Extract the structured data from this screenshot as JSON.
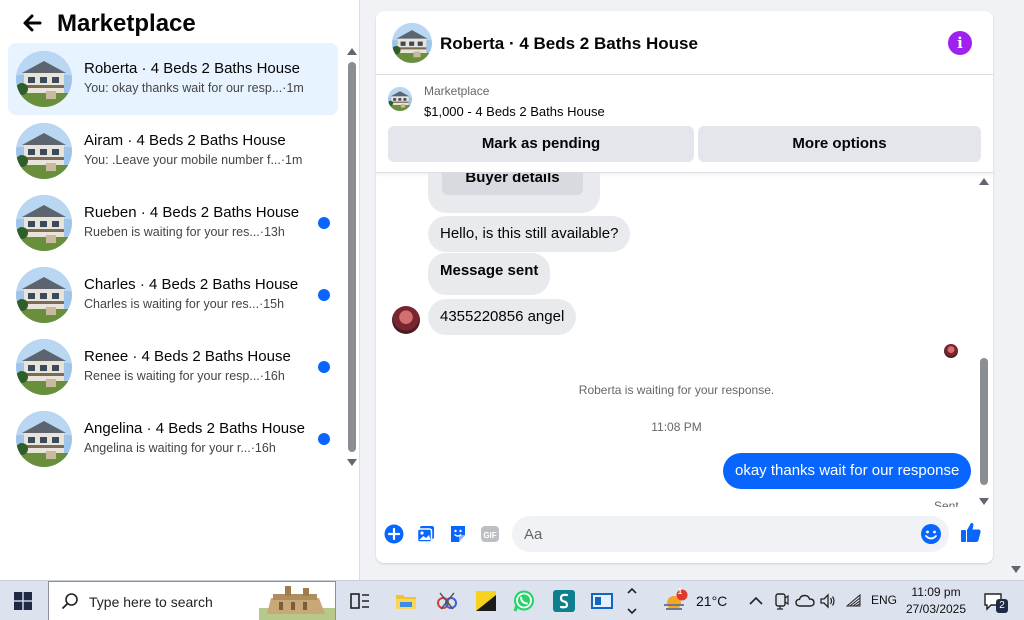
{
  "left_panel": {
    "title": "Marketplace",
    "conversations": [
      {
        "title": "Roberta · 4 Beds 2 Baths House",
        "preview": "You: okay thanks wait for our resp...",
        "time": "1m",
        "unread": false,
        "active": true
      },
      {
        "title": "Airam · 4 Beds 2 Baths House",
        "preview": "You: .Leave your mobile number f...",
        "time": "1m",
        "unread": false,
        "active": false
      },
      {
        "title": "Rueben · 4 Beds 2 Baths House",
        "preview": "Rueben is waiting for your res...",
        "time": "13h",
        "unread": true,
        "active": false
      },
      {
        "title": "Charles · 4 Beds 2 Baths House",
        "preview": "Charles is waiting for your res...",
        "time": "15h",
        "unread": true,
        "active": false
      },
      {
        "title": "Renee · 4 Beds 2 Baths House",
        "preview": "Renee is waiting for your resp...",
        "time": "16h",
        "unread": true,
        "active": false
      },
      {
        "title": "Angelina · 4 Beds 2 Baths House",
        "preview": "Angelina is waiting for your r...",
        "time": "16h",
        "unread": true,
        "active": false
      }
    ]
  },
  "chat": {
    "header_title": "Roberta · 4 Beds 2 Baths House",
    "listing": {
      "source": "Marketplace",
      "price_title": "$1,000 - 4 Beds 2 Baths House"
    },
    "actions": {
      "pending": "Mark as pending",
      "more": "More options"
    },
    "messages": {
      "buyer_details": "Buyer details",
      "hello": "Hello, is this still available?",
      "message_sent": "Message sent",
      "phone": "4355220856 angel",
      "waiting_note": "Roberta is waiting for your response.",
      "timestamp": "11:08 PM",
      "outgoing": "okay thanks wait for our response",
      "sent_status": "Sent"
    },
    "composer": {
      "placeholder": "Aa"
    }
  },
  "taskbar": {
    "search_placeholder": "Type here to search",
    "weather": "21°C",
    "weather_badge": "1",
    "language": "ENG",
    "time": "11:09 pm",
    "date": "27/03/2025",
    "notification_count": "2"
  },
  "colors": {
    "accent": "#0866ff",
    "info": "#a020f0",
    "bubble_in": "#e9eaed",
    "active_row": "#e7f3ff"
  }
}
